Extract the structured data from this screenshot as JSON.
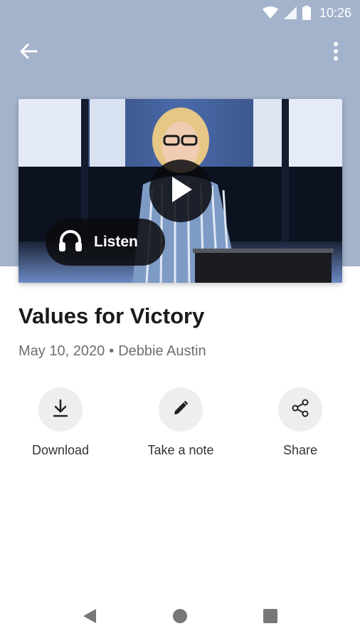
{
  "status_bar": {
    "time": "10:26",
    "icons": [
      "wifi-icon",
      "signal-icon",
      "battery-icon"
    ]
  },
  "app_bar": {
    "back_icon": "arrow-back-icon",
    "menu_icon": "more-vert-icon"
  },
  "colors": {
    "header_band": "#a4b3cc",
    "title": "#1a1a1a",
    "meta": "#6e6e6e",
    "action_circle": "#eeeeee"
  },
  "video": {
    "play_icon": "play-icon",
    "listen_label": "Listen",
    "listen_icon": "headphones-icon"
  },
  "sermon": {
    "title": "Values for Victory",
    "date": "May 10, 2020",
    "separator": "•",
    "speaker": "Debbie Austin"
  },
  "actions": [
    {
      "label": "Download",
      "icon": "download-icon"
    },
    {
      "label": "Take a note",
      "icon": "pencil-icon"
    },
    {
      "label": "Share",
      "icon": "share-icon"
    }
  ],
  "nav_bar": {
    "icons": [
      "back-triangle-icon",
      "home-circle-icon",
      "recents-square-icon"
    ]
  }
}
